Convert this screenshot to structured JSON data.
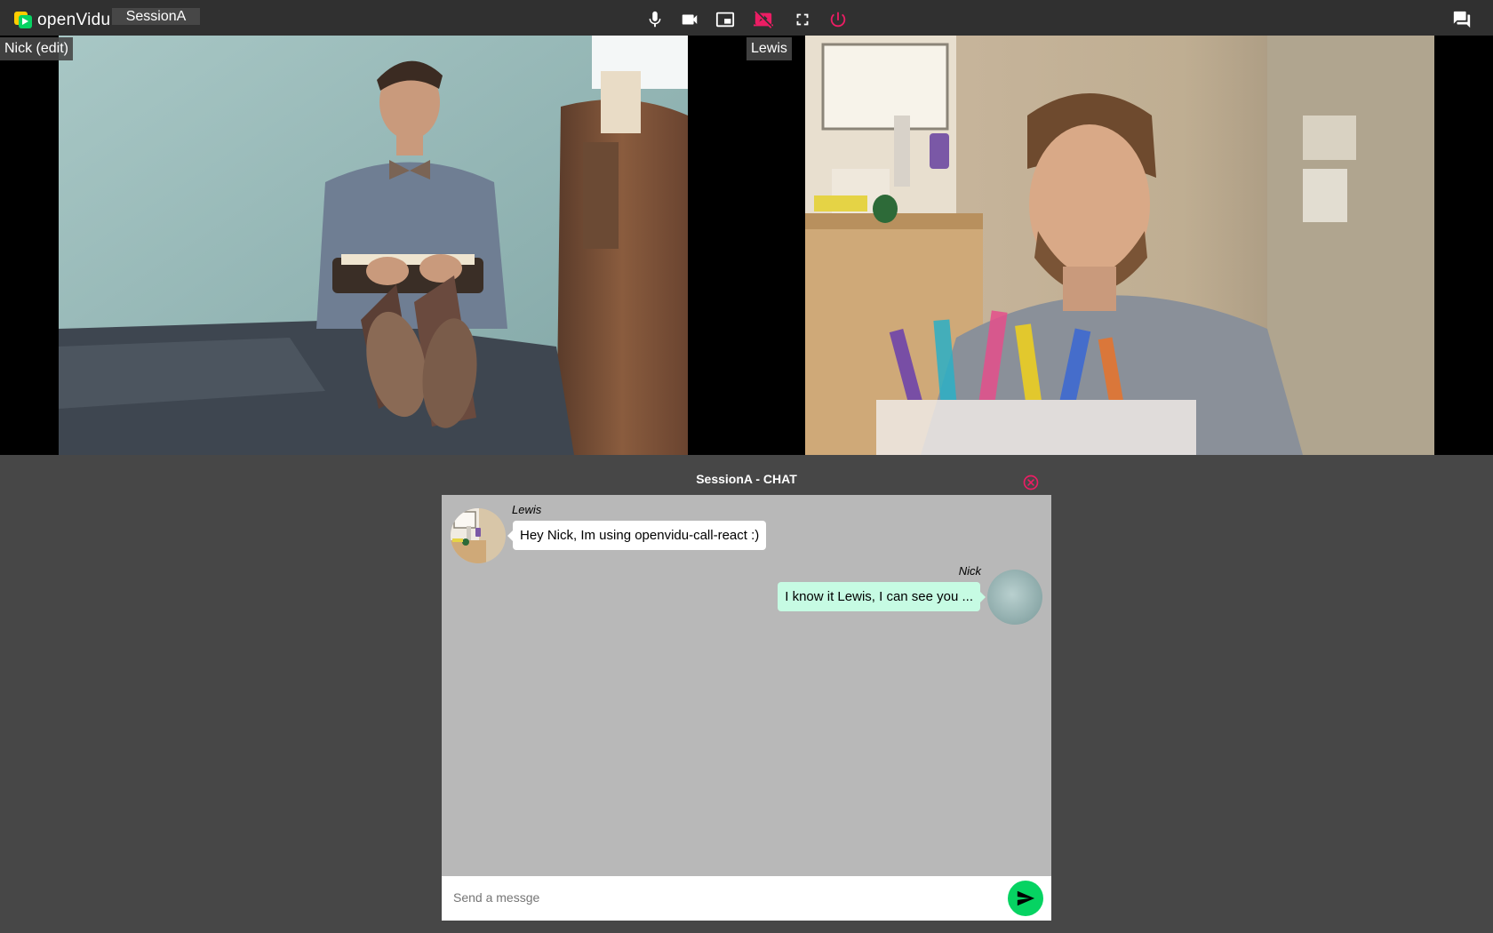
{
  "app": {
    "logo_text": "openVidu",
    "session_name": "SessionA"
  },
  "toolbar": {
    "buttons": [
      {
        "icon": "mic-icon",
        "label": "Mute microphone"
      },
      {
        "icon": "videocam-icon",
        "label": "Camera"
      },
      {
        "icon": "picture-in-picture-icon",
        "label": "Switch camera"
      },
      {
        "icon": "stop-screen-share-icon",
        "label": "Screen share",
        "color": "#ec1d64"
      },
      {
        "icon": "fullscreen-icon",
        "label": "Fullscreen"
      },
      {
        "icon": "power-icon",
        "label": "Leave session",
        "color": "#ec1d64"
      }
    ],
    "chat_icon": "forum-icon"
  },
  "videos": {
    "local": {
      "name": "Nick (edit)"
    },
    "remote": {
      "name": "Lewis"
    }
  },
  "chat": {
    "title": "SessionA - CHAT",
    "close_icon": "close-circle-icon",
    "messages": [
      {
        "author": "Lewis",
        "text": "Hey Nick, Im using openvidu-call-react :)",
        "side": "left"
      },
      {
        "author": "Nick",
        "text": "I know it Lewis, I can see you ...",
        "side": "right"
      }
    ],
    "input": {
      "placeholder": "Send a messge",
      "value": ""
    },
    "send_icon": "send-icon"
  },
  "colors": {
    "toolbar_bg": "#303030",
    "page_bg": "#474747",
    "accent_pink": "#ec1d64",
    "accent_green": "#06d362",
    "chat_bg": "#b8b8b8",
    "own_bubble": "#c6fbe3"
  }
}
